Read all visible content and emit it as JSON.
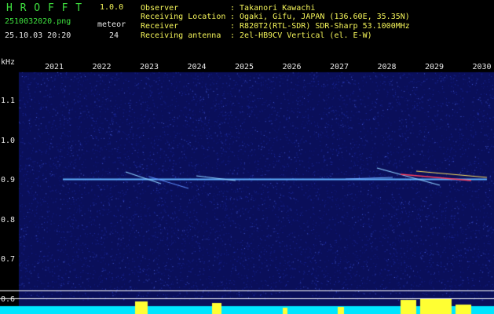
{
  "app": {
    "logo": "H R O F F T",
    "version": "1.0.0"
  },
  "left_panel": {
    "filename": "2510032020.png",
    "datetime": "25.10.03 20:20",
    "count_label": "meteor",
    "count_value": "24"
  },
  "info": {
    "observer_label": "Observer",
    "observer_value": ": Takanori Kawachi",
    "location_label": "Receiving Location",
    "location_value": ": Ogaki, Gifu, JAPAN (136.60E, 35.35N)",
    "receiver_label": "Receiver",
    "receiver_value": ": R820T2(RTL-SDR) SDR-Sharp 53.1000MHz",
    "antenna_label": "Receiving antenna",
    "antenna_value": ": 2el-HB9CV Vertical (el. E-W)"
  },
  "chart_data": {
    "type": "heatmap",
    "ylabel": "kHz",
    "x_ticks": [
      "2021",
      "2022",
      "2023",
      "2024",
      "2025",
      "2026",
      "2027",
      "2028",
      "2029",
      "2030"
    ],
    "y_ticks": [
      "1.1",
      "1.0",
      "0.9",
      "0.8",
      "0.7",
      "0.6"
    ],
    "carrier_khz": 0.905,
    "palette": {
      "background": "#0a0f5a",
      "noise": "#3040c0",
      "carrier": "#5fb0ff",
      "meteor": "#ff4060",
      "power": "#00e5ff",
      "peaks": "#ffff33",
      "guide": "#ffffff"
    }
  }
}
